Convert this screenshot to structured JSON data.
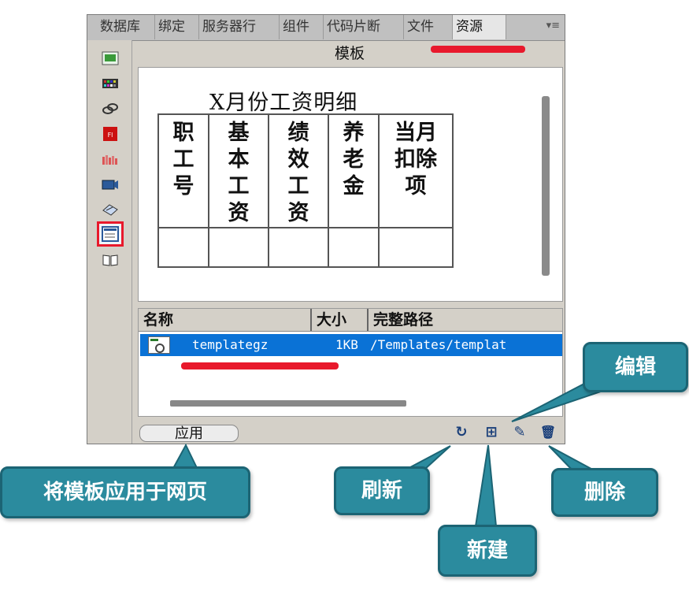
{
  "tabs": [
    {
      "label": "数据库",
      "active": false
    },
    {
      "label": "绑定",
      "active": false
    },
    {
      "label": "服务器行",
      "active": false
    },
    {
      "label": "组件",
      "active": false
    },
    {
      "label": "代码片断",
      "active": false
    },
    {
      "label": "文件",
      "active": false
    },
    {
      "label": "资源",
      "active": true
    }
  ],
  "tab_menu_glyph": "▾≡",
  "panel_title": "模板",
  "template_preview": {
    "title": "X月份工资明细",
    "headers": [
      "职工号",
      "基本工资",
      "绩效工资",
      "养老金",
      "当月扣除项"
    ]
  },
  "file_list": {
    "columns": [
      "名称",
      "大小",
      "完整路径"
    ],
    "rows": [
      {
        "name": "templategz",
        "size": "1KB",
        "path": "/Templates/templat"
      }
    ]
  },
  "bottom": {
    "apply_label": "应用",
    "refresh_glyph": "↻",
    "new_glyph": "⊞",
    "edit_glyph": "✎",
    "delete_glyph": "🗑"
  },
  "callouts": {
    "apply": "将模板应用于网页",
    "refresh": "刷新",
    "new": "新建",
    "edit": "编辑",
    "delete": "删除"
  },
  "colors": {
    "accent_red": "#e8192c",
    "callout_teal": "#2b8b9e",
    "selection_blue": "#0a72d6"
  },
  "sidebar_icons": [
    "images-icon",
    "colors-icon",
    "urls-icon",
    "flash-icon",
    "shockwave-icon",
    "movies-icon",
    "scripts-icon",
    "templates-icon",
    "library-icon"
  ]
}
